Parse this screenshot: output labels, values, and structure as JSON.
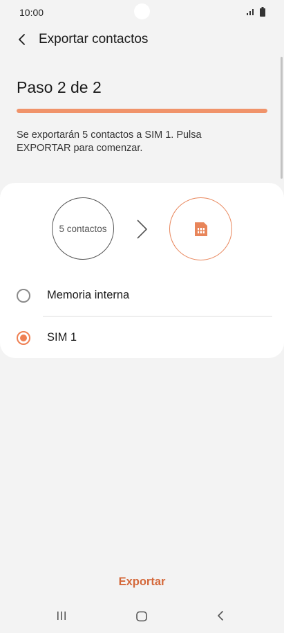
{
  "status_bar": {
    "time": "10:00"
  },
  "app_bar": {
    "title": "Exportar contactos"
  },
  "step": {
    "title": "Paso 2 de 2",
    "progress": 1.0
  },
  "description": "Se exportarán 5 contactos a SIM 1. Pulsa EXPORTAR para comenzar.",
  "transfer": {
    "source_label": "5 contactos"
  },
  "options": [
    {
      "label": "Memoria interna",
      "selected": false
    },
    {
      "label": "SIM 1",
      "selected": true
    }
  ],
  "export_button": "Exportar",
  "colors": {
    "accent": "#ef8053",
    "button_text": "#d4683a",
    "background": "#f3f3f3"
  }
}
